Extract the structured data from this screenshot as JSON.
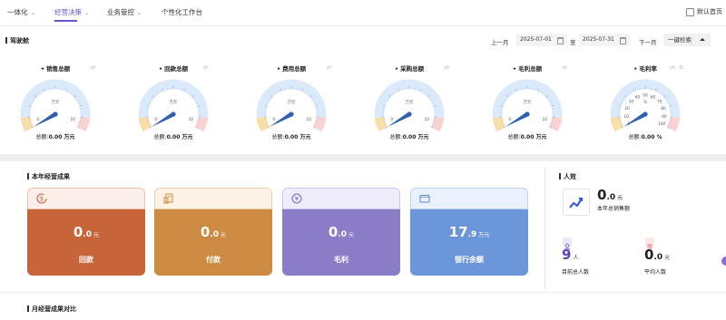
{
  "nav": {
    "items": [
      {
        "label": "一体化"
      },
      {
        "label": "经营决策"
      },
      {
        "label": "业务管控"
      },
      {
        "label": "个性化工作台"
      }
    ],
    "default_home": "默认首页"
  },
  "dashboard": {
    "title": "驾驶舱",
    "prev_month": "上一月",
    "next_month": "下一月",
    "start_date": "2025-07-01",
    "to": "至",
    "end_date": "2025-07-31",
    "search": "一键检索"
  },
  "gauges": [
    {
      "title": "销售总额",
      "unit": "万元",
      "total_label": "总额:",
      "total": "0.00 万元",
      "value": 0,
      "ticks": [
        "0",
        "10"
      ]
    },
    {
      "title": "回款总额",
      "unit": "万元",
      "total_label": "总额:",
      "total": "0.00 万元",
      "value": 0,
      "ticks": [
        "0",
        "10"
      ]
    },
    {
      "title": "费用总额",
      "unit": "万元",
      "total_label": "总额:",
      "total": "0.00 万元",
      "value": 0,
      "ticks": [
        "0",
        "10"
      ]
    },
    {
      "title": "采购总额",
      "unit": "万元",
      "total_label": "总额:",
      "total": "0.00 万元",
      "value": 0,
      "ticks": [
        "0",
        "10"
      ]
    },
    {
      "title": "毛利总额",
      "unit": "万元",
      "total_label": "总额:",
      "total": "0.00 万元",
      "value": 0,
      "ticks": [
        "0",
        "10"
      ]
    },
    {
      "title": "毛利率",
      "unit": "%",
      "total_label": "总额:",
      "total": "0.00 %",
      "value": 0,
      "ticks": [
        "0",
        "10",
        "20",
        "30",
        "40",
        "50",
        "60",
        "70",
        "80",
        "90",
        "100"
      ]
    }
  ],
  "yearly": {
    "title": "本年经营成果",
    "cards": [
      {
        "label": "回款",
        "int": "0",
        "dec": ".0",
        "unit": "元",
        "color": "#c8643a",
        "top_color": "#fceee8",
        "icon": "dollar-circle-icon"
      },
      {
        "label": "付款",
        "int": "0",
        "dec": ".0",
        "unit": "元",
        "color": "#cd8a42",
        "top_color": "#fdf2e6",
        "icon": "receipt-icon"
      },
      {
        "label": "毛利",
        "int": "0",
        "dec": ".0",
        "unit": "元",
        "color": "#8b7cc8",
        "top_color": "#efecfb",
        "icon": "yen-circle-icon"
      },
      {
        "label": "银行余额",
        "int": "17",
        "dec": ".9",
        "unit": "万元",
        "color": "#6b97da",
        "top_color": "#e9f1fc",
        "icon": "wallet-icon"
      }
    ]
  },
  "people": {
    "title": "人效",
    "sales_int": "0",
    "sales_dec": ".0",
    "sales_unit": "元",
    "sales_label": "本年总销售额",
    "headcount": "9",
    "headcount_unit": "人",
    "headcount_label": "目前总人数",
    "avg_int": "0",
    "avg_dec": ".0",
    "avg_unit": "元",
    "avg_label": "平均人数"
  },
  "monthly": {
    "title": "月经营成果对比"
  }
}
